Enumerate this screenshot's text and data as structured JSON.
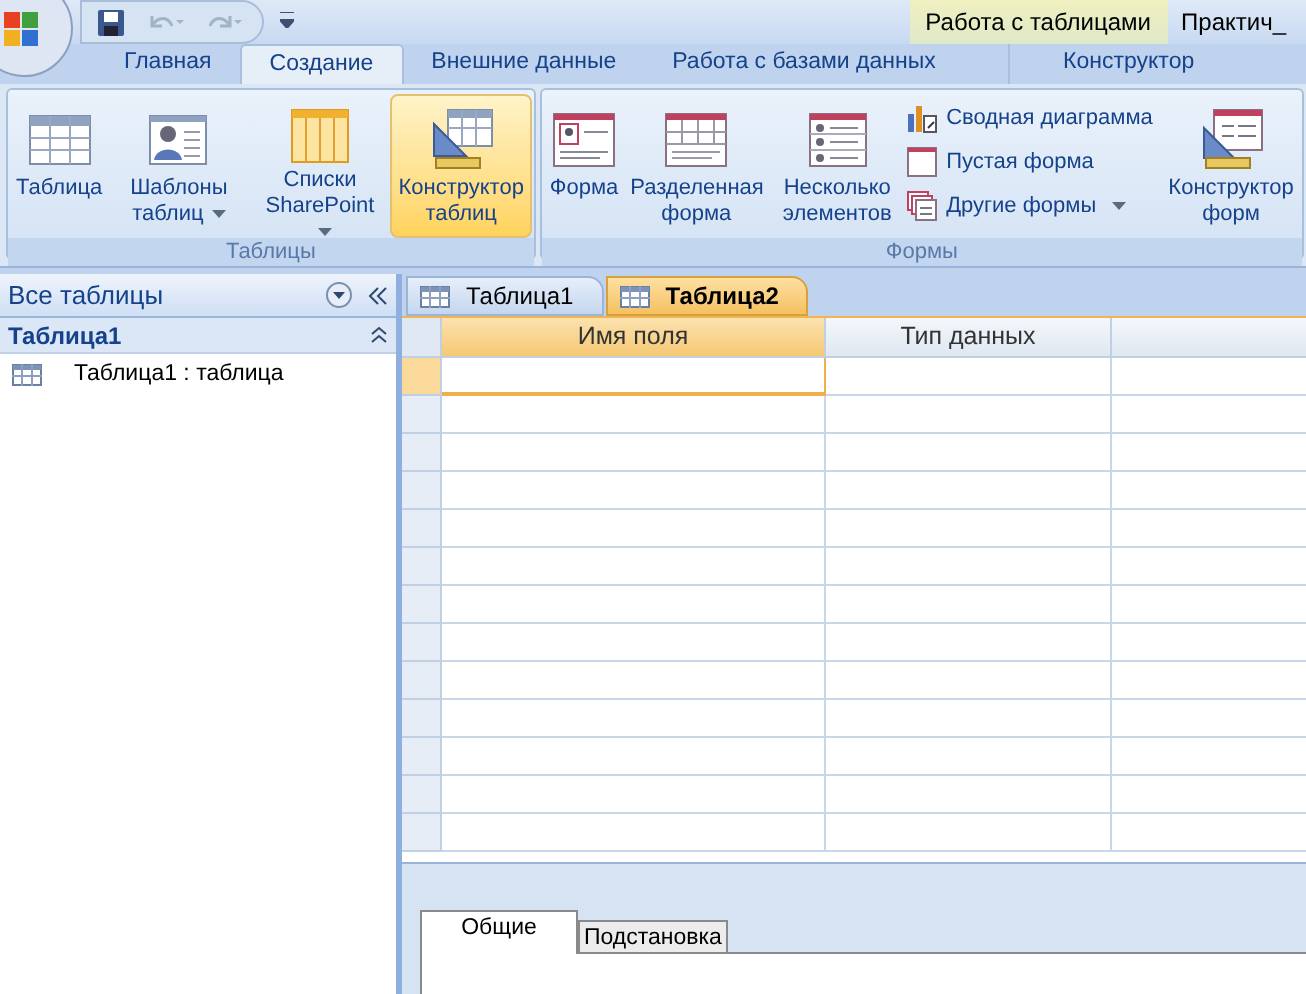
{
  "title_bar": {
    "context_tab": "Работа с таблицами",
    "title": "Практич_"
  },
  "ribbon_tabs": [
    {
      "label": "Главная",
      "selected": false,
      "kind": "normal"
    },
    {
      "label": "Создание",
      "selected": true,
      "kind": "normal"
    },
    {
      "label": "Внешние данные",
      "selected": false,
      "kind": "normal"
    },
    {
      "label": "Работа с базами данных",
      "selected": false,
      "kind": "normal"
    },
    {
      "label": "Конструктор",
      "selected": false,
      "kind": "contextual"
    }
  ],
  "groups": [
    {
      "label": "Таблицы",
      "items": [
        {
          "kind": "large",
          "label": "Таблица",
          "dropdown": false,
          "selected": false
        },
        {
          "kind": "large",
          "label": "Шаблоны таблиц",
          "dropdown": true,
          "selected": false
        },
        {
          "kind": "large",
          "label": "Списки SharePoint",
          "dropdown": true,
          "selected": false
        },
        {
          "kind": "large",
          "label": "Конструктор таблиц",
          "dropdown": false,
          "selected": true
        }
      ]
    },
    {
      "label": "Формы",
      "items": [
        {
          "kind": "large",
          "label": "Форма",
          "dropdown": false,
          "selected": false
        },
        {
          "kind": "large",
          "label": "Разделенная форма",
          "dropdown": false,
          "selected": false
        },
        {
          "kind": "large",
          "label": "Несколько элементов",
          "dropdown": false,
          "selected": false
        },
        {
          "kind": "small",
          "entries": [
            {
              "label": "Сводная диаграмма",
              "dropdown": false
            },
            {
              "label": "Пустая форма",
              "dropdown": false
            },
            {
              "label": "Другие формы",
              "dropdown": true
            }
          ]
        },
        {
          "kind": "large",
          "label": "Конструктор форм",
          "dropdown": false,
          "selected": false
        }
      ]
    }
  ],
  "nav_pane": {
    "header": "Все таблицы",
    "groups": [
      {
        "label": "Таблица1",
        "expanded": true,
        "children": [
          {
            "label": "Таблица1 : таблица"
          }
        ]
      }
    ]
  },
  "doc_tabs": [
    {
      "label": "Таблица1",
      "selected": false
    },
    {
      "label": "Таблица2",
      "selected": true
    }
  ],
  "design_grid": {
    "columns": [
      "Имя поля",
      "Тип данных"
    ],
    "rows": [
      {
        "selected": true
      },
      {
        "selected": false
      },
      {
        "selected": false
      },
      {
        "selected": false
      },
      {
        "selected": false
      },
      {
        "selected": false
      },
      {
        "selected": false
      },
      {
        "selected": false
      },
      {
        "selected": false
      },
      {
        "selected": false
      },
      {
        "selected": false
      },
      {
        "selected": false
      },
      {
        "selected": false
      }
    ]
  },
  "property_tabs": [
    {
      "label": "Общие",
      "selected": true
    },
    {
      "label": "Подстановка",
      "selected": false
    }
  ]
}
